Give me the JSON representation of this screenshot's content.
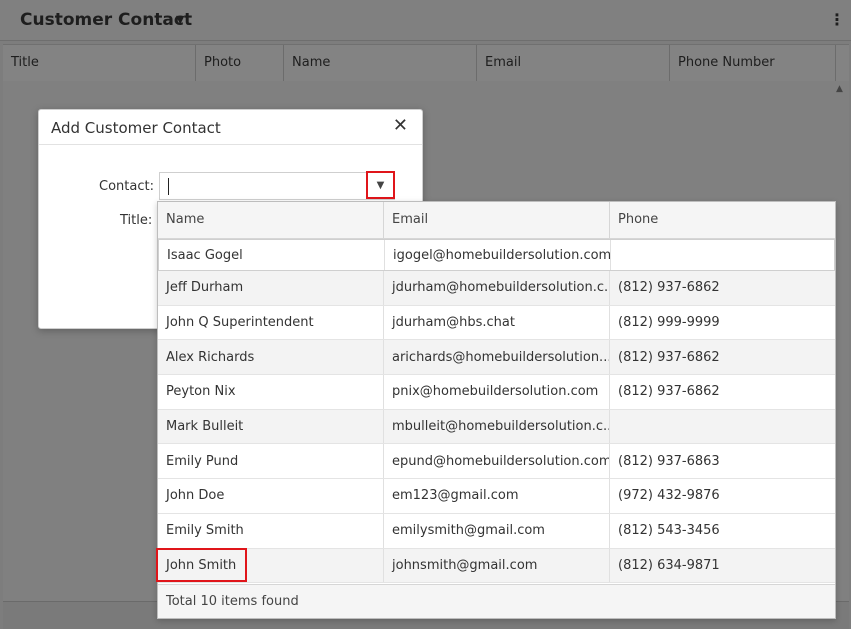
{
  "panel": {
    "title": "Customer Contact",
    "columns": [
      "Title",
      "Photo",
      "Name",
      "Email",
      "Phone Number"
    ]
  },
  "modal": {
    "title": "Add Customer Contact",
    "contact_label": "Contact:",
    "contact_value": "",
    "title_label": "Title:"
  },
  "dropdown": {
    "columns": [
      "Name",
      "Email",
      "Phone"
    ],
    "rows": [
      {
        "name": "Isaac Gogel",
        "email": "igogel@homebuildersolution.com",
        "phone": ""
      },
      {
        "name": "Jeff Durham",
        "email": "jdurham@homebuildersolution.c...",
        "phone": "(812) 937-6862"
      },
      {
        "name": "John Q Superintendent",
        "email": "jdurham@hbs.chat",
        "phone": "(812) 999-9999"
      },
      {
        "name": "Alex Richards",
        "email": "arichards@homebuildersolution....",
        "phone": "(812) 937-6862"
      },
      {
        "name": "Peyton Nix",
        "email": "pnix@homebuildersolution.com",
        "phone": "(812) 937-6862"
      },
      {
        "name": "Mark Bulleit",
        "email": "mbulleit@homebuildersolution.c...",
        "phone": ""
      },
      {
        "name": "Emily Pund",
        "email": "epund@homebuildersolution.com",
        "phone": "(812) 937-6863"
      },
      {
        "name": "John Doe",
        "email": "em123@gmail.com",
        "phone": "(972) 432-9876"
      },
      {
        "name": "Emily Smith",
        "email": "emilysmith@gmail.com",
        "phone": "(812) 543-3456"
      },
      {
        "name": "John Smith",
        "email": "johnsmith@gmail.com",
        "phone": "(812) 634-9871"
      }
    ],
    "footer": "Total 10 items found"
  },
  "colors": {
    "highlight": "#e0151a"
  }
}
